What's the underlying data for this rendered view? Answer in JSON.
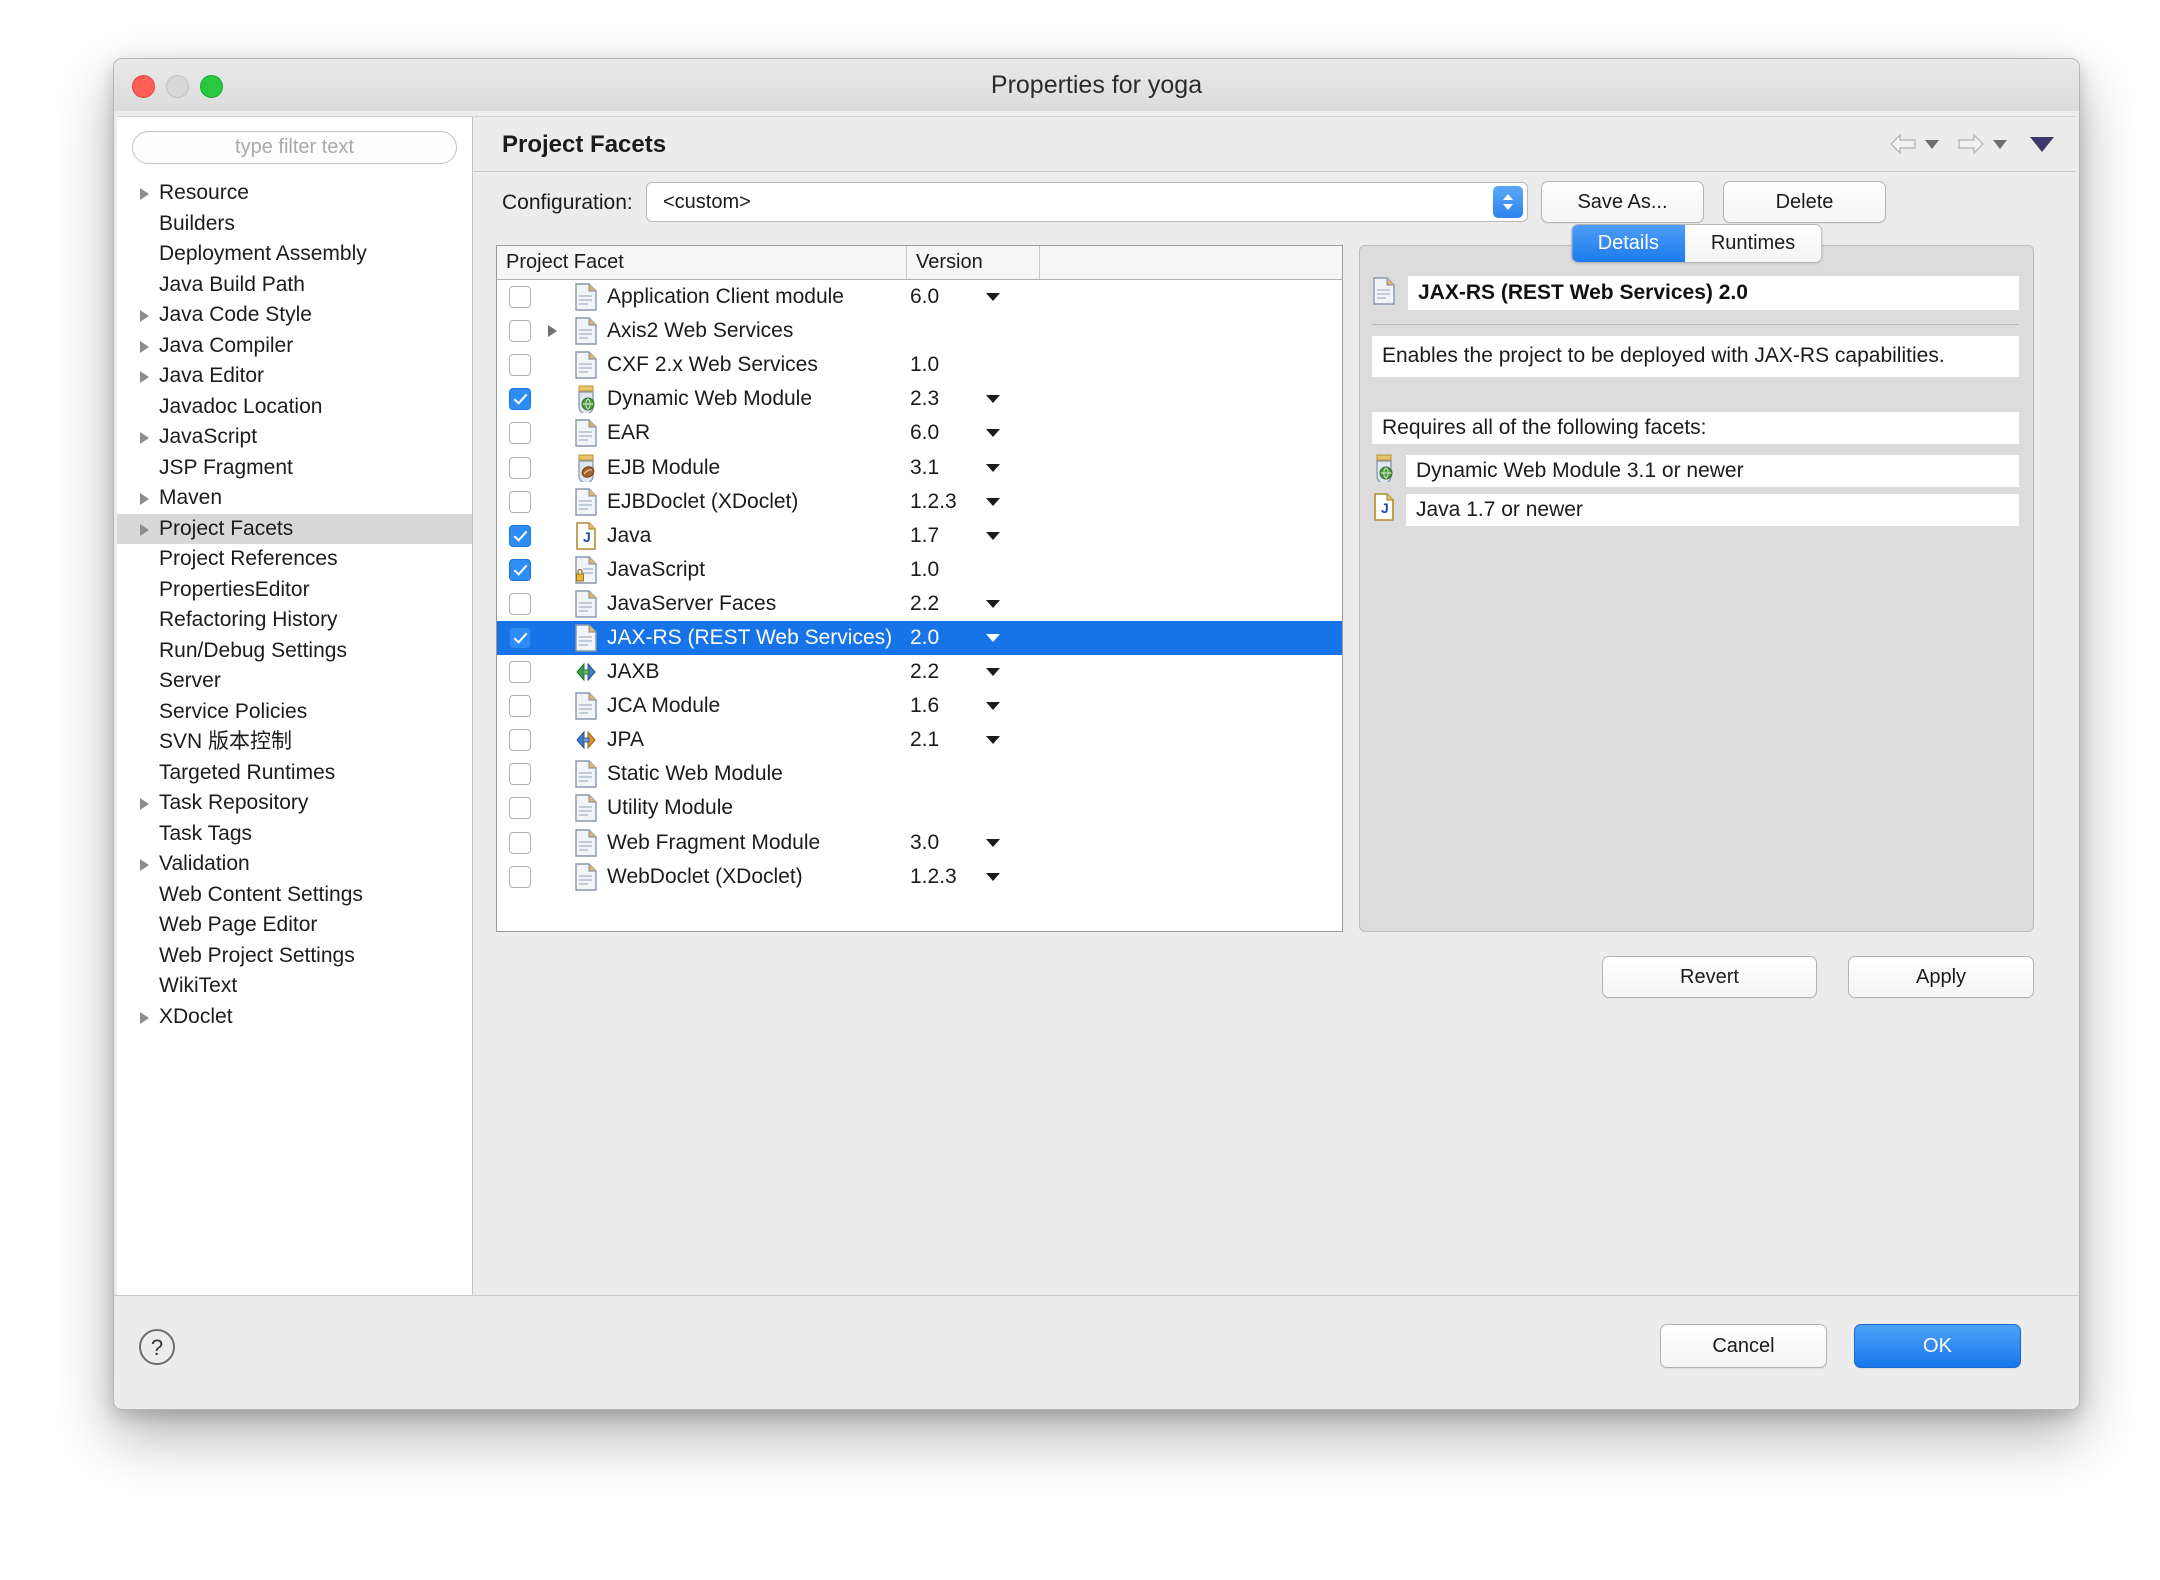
{
  "window": {
    "title": "Properties for yoga",
    "traffic_lights": [
      "close-button",
      "minimize-button",
      "zoom-button"
    ]
  },
  "sidebar": {
    "filter_placeholder": "type filter text",
    "items": [
      {
        "label": "Resource",
        "expandable": true,
        "selected": false
      },
      {
        "label": "Builders",
        "expandable": false,
        "selected": false
      },
      {
        "label": "Deployment Assembly",
        "expandable": false,
        "selected": false
      },
      {
        "label": "Java Build Path",
        "expandable": false,
        "selected": false
      },
      {
        "label": "Java Code Style",
        "expandable": true,
        "selected": false
      },
      {
        "label": "Java Compiler",
        "expandable": true,
        "selected": false
      },
      {
        "label": "Java Editor",
        "expandable": true,
        "selected": false
      },
      {
        "label": "Javadoc Location",
        "expandable": false,
        "selected": false
      },
      {
        "label": "JavaScript",
        "expandable": true,
        "selected": false
      },
      {
        "label": "JSP Fragment",
        "expandable": false,
        "selected": false
      },
      {
        "label": "Maven",
        "expandable": true,
        "selected": false
      },
      {
        "label": "Project Facets",
        "expandable": true,
        "selected": true
      },
      {
        "label": "Project References",
        "expandable": false,
        "selected": false
      },
      {
        "label": "PropertiesEditor",
        "expandable": false,
        "selected": false
      },
      {
        "label": "Refactoring History",
        "expandable": false,
        "selected": false
      },
      {
        "label": "Run/Debug Settings",
        "expandable": false,
        "selected": false
      },
      {
        "label": "Server",
        "expandable": false,
        "selected": false
      },
      {
        "label": "Service Policies",
        "expandable": false,
        "selected": false
      },
      {
        "label": "SVN 版本控制",
        "expandable": false,
        "selected": false
      },
      {
        "label": "Targeted Runtimes",
        "expandable": false,
        "selected": false
      },
      {
        "label": "Task Repository",
        "expandable": true,
        "selected": false
      },
      {
        "label": "Task Tags",
        "expandable": false,
        "selected": false
      },
      {
        "label": "Validation",
        "expandable": true,
        "selected": false
      },
      {
        "label": "Web Content Settings",
        "expandable": false,
        "selected": false
      },
      {
        "label": "Web Page Editor",
        "expandable": false,
        "selected": false
      },
      {
        "label": "Web Project Settings",
        "expandable": false,
        "selected": false
      },
      {
        "label": "WikiText",
        "expandable": false,
        "selected": false
      },
      {
        "label": "XDoclet",
        "expandable": true,
        "selected": false
      }
    ]
  },
  "page": {
    "title": "Project Facets",
    "nav": {
      "back": "back-arrow",
      "forward": "forward-arrow",
      "menu": "view-menu"
    }
  },
  "configuration": {
    "label": "Configuration:",
    "value": "<custom>",
    "save_as_label": "Save As...",
    "delete_label": "Delete"
  },
  "facet_table": {
    "columns": [
      "Project Facet",
      "Version",
      ""
    ],
    "rows": [
      {
        "checked": false,
        "expandable": false,
        "icon": "document-icon",
        "name": "Application Client module",
        "version": "6.0",
        "has_dropdown": true,
        "selected": false
      },
      {
        "checked": false,
        "expandable": true,
        "icon": "document-icon",
        "name": "Axis2 Web Services",
        "version": "",
        "has_dropdown": false,
        "selected": false
      },
      {
        "checked": false,
        "expandable": false,
        "icon": "document-icon",
        "name": "CXF 2.x Web Services",
        "version": "1.0",
        "has_dropdown": false,
        "selected": false
      },
      {
        "checked": true,
        "expandable": false,
        "icon": "web-module-icon",
        "name": "Dynamic Web Module",
        "version": "2.3",
        "has_dropdown": true,
        "selected": false
      },
      {
        "checked": false,
        "expandable": false,
        "icon": "document-icon",
        "name": "EAR",
        "version": "6.0",
        "has_dropdown": true,
        "selected": false
      },
      {
        "checked": false,
        "expandable": false,
        "icon": "ejb-bean-icon",
        "name": "EJB Module",
        "version": "3.1",
        "has_dropdown": true,
        "selected": false
      },
      {
        "checked": false,
        "expandable": false,
        "icon": "document-icon",
        "name": "EJBDoclet (XDoclet)",
        "version": "1.2.3",
        "has_dropdown": true,
        "selected": false
      },
      {
        "checked": true,
        "expandable": false,
        "icon": "java-file-icon",
        "name": "Java",
        "version": "1.7",
        "has_dropdown": true,
        "selected": false
      },
      {
        "checked": true,
        "expandable": false,
        "icon": "js-lock-icon",
        "name": "JavaScript",
        "version": "1.0",
        "has_dropdown": false,
        "selected": false
      },
      {
        "checked": false,
        "expandable": false,
        "icon": "document-icon",
        "name": "JavaServer Faces",
        "version": "2.2",
        "has_dropdown": true,
        "selected": false
      },
      {
        "checked": true,
        "expandable": false,
        "icon": "document-icon",
        "name": "JAX-RS (REST Web Services)",
        "version": "2.0",
        "has_dropdown": true,
        "selected": true
      },
      {
        "checked": false,
        "expandable": false,
        "icon": "green-arrows-icon",
        "name": "JAXB",
        "version": "2.2",
        "has_dropdown": true,
        "selected": false
      },
      {
        "checked": false,
        "expandable": false,
        "icon": "document-icon",
        "name": "JCA Module",
        "version": "1.6",
        "has_dropdown": true,
        "selected": false
      },
      {
        "checked": false,
        "expandable": false,
        "icon": "orange-arrows-icon",
        "name": "JPA",
        "version": "2.1",
        "has_dropdown": true,
        "selected": false
      },
      {
        "checked": false,
        "expandable": false,
        "icon": "document-icon",
        "name": "Static Web Module",
        "version": "",
        "has_dropdown": false,
        "selected": false
      },
      {
        "checked": false,
        "expandable": false,
        "icon": "document-icon",
        "name": "Utility Module",
        "version": "",
        "has_dropdown": false,
        "selected": false
      },
      {
        "checked": false,
        "expandable": false,
        "icon": "document-icon",
        "name": "Web Fragment Module",
        "version": "3.0",
        "has_dropdown": true,
        "selected": false
      },
      {
        "checked": false,
        "expandable": false,
        "icon": "document-icon",
        "name": "WebDoclet (XDoclet)",
        "version": "1.2.3",
        "has_dropdown": true,
        "selected": false
      }
    ]
  },
  "details": {
    "tabs": [
      {
        "label": "Details",
        "active": true
      },
      {
        "label": "Runtimes",
        "active": false
      }
    ],
    "facet_title": "JAX-RS (REST Web Services) 2.0",
    "description": "Enables the project to be deployed with JAX-RS capabilities.",
    "requires_label": "Requires all of the following facets:",
    "requirements": [
      {
        "icon": "web-module-icon",
        "text": "Dynamic Web Module 3.1 or newer"
      },
      {
        "icon": "java-file-icon",
        "text": "Java 1.7 or newer"
      }
    ]
  },
  "actions": {
    "revert_label": "Revert",
    "apply_label": "Apply",
    "cancel_label": "Cancel",
    "ok_label": "OK",
    "help_label": "?"
  },
  "colors": {
    "accent_blue": "#1673e8",
    "selection_blue": "#2d8cf5",
    "window_bg": "#ececec"
  }
}
